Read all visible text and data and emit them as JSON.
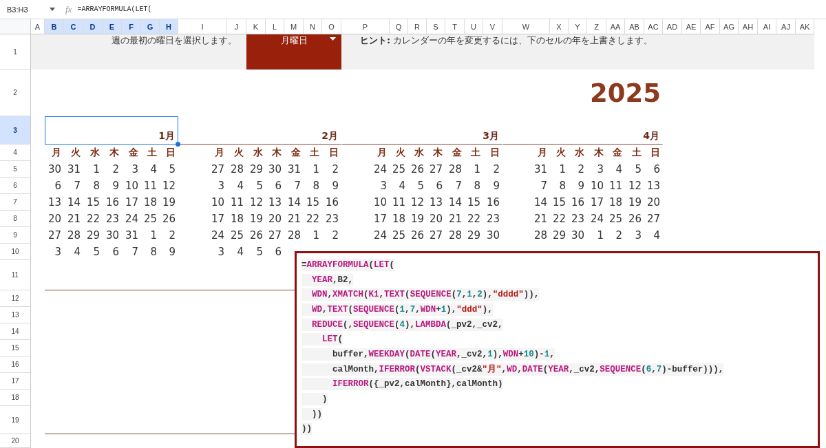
{
  "formula_bar": {
    "name_box": "B3:H3",
    "fx": "fx",
    "formula": "=ARRAYFORMULA(LET("
  },
  "columns": [
    {
      "label": "A",
      "selected": false
    },
    {
      "label": "B",
      "selected": true
    },
    {
      "label": "C",
      "selected": true
    },
    {
      "label": "D",
      "selected": true
    },
    {
      "label": "E",
      "selected": true
    },
    {
      "label": "F",
      "selected": true
    },
    {
      "label": "G",
      "selected": true
    },
    {
      "label": "H",
      "selected": true
    },
    {
      "label": "I",
      "selected": false
    },
    {
      "label": "J",
      "selected": false
    },
    {
      "label": "K",
      "selected": false
    },
    {
      "label": "L",
      "selected": false
    },
    {
      "label": "M",
      "selected": false
    },
    {
      "label": "N",
      "selected": false
    },
    {
      "label": "O",
      "selected": false
    },
    {
      "label": "P",
      "selected": false
    },
    {
      "label": "Q",
      "selected": false
    },
    {
      "label": "R",
      "selected": false
    },
    {
      "label": "S",
      "selected": false
    },
    {
      "label": "T",
      "selected": false
    },
    {
      "label": "U",
      "selected": false
    },
    {
      "label": "V",
      "selected": false
    },
    {
      "label": "W",
      "selected": false
    },
    {
      "label": "X",
      "selected": false
    },
    {
      "label": "Y",
      "selected": false
    },
    {
      "label": "Z",
      "selected": false
    },
    {
      "label": "AA",
      "selected": false
    },
    {
      "label": "AB",
      "selected": false
    },
    {
      "label": "AC",
      "selected": false
    },
    {
      "label": "AD",
      "selected": false
    },
    {
      "label": "AE",
      "selected": false
    },
    {
      "label": "AF",
      "selected": false
    },
    {
      "label": "AG",
      "selected": false
    },
    {
      "label": "AH",
      "selected": false
    },
    {
      "label": "AI",
      "selected": false
    },
    {
      "label": "AJ",
      "selected": false
    },
    {
      "label": "AK",
      "selected": false
    }
  ],
  "rows": [
    {
      "label": "1",
      "selected": false
    },
    {
      "label": "2",
      "selected": false
    },
    {
      "label": "3",
      "selected": true
    },
    {
      "label": "4",
      "selected": false
    },
    {
      "label": "5",
      "selected": false
    },
    {
      "label": "6",
      "selected": false
    },
    {
      "label": "7",
      "selected": false
    },
    {
      "label": "8",
      "selected": false
    },
    {
      "label": "9",
      "selected": false
    },
    {
      "label": "10",
      "selected": false
    },
    {
      "label": "11",
      "selected": false
    },
    {
      "label": "12",
      "selected": false
    },
    {
      "label": "13",
      "selected": false
    },
    {
      "label": "14",
      "selected": false
    },
    {
      "label": "15",
      "selected": false
    },
    {
      "label": "16",
      "selected": false
    },
    {
      "label": "17",
      "selected": false
    },
    {
      "label": "18",
      "selected": false
    },
    {
      "label": "19",
      "selected": false
    },
    {
      "label": "20",
      "selected": false
    }
  ],
  "intro_text": "週の最初の曜日を選択します。",
  "week_start_dropdown": {
    "value": "月曜日"
  },
  "hint": "**ヒント:** カレンダーの年を変更するには、下のセルの年を上書きします。",
  "year": "2025",
  "months": [
    {
      "label": "1月",
      "selected": true,
      "weekdays": [
        "月",
        "火",
        "水",
        "木",
        "金",
        "土",
        "日"
      ],
      "weeks": [
        [
          "30",
          "31",
          "1",
          "2",
          "3",
          "4",
          "5"
        ],
        [
          "6",
          "7",
          "8",
          "9",
          "10",
          "11",
          "12"
        ],
        [
          "13",
          "14",
          "15",
          "16",
          "17",
          "18",
          "19"
        ],
        [
          "20",
          "21",
          "22",
          "23",
          "24",
          "25",
          "26"
        ],
        [
          "27",
          "28",
          "29",
          "30",
          "31",
          "1",
          "2"
        ],
        [
          "3",
          "4",
          "5",
          "6",
          "7",
          "8",
          "9"
        ]
      ]
    },
    {
      "label": "2月",
      "selected": false,
      "weekdays": [
        "月",
        "火",
        "水",
        "木",
        "金",
        "土",
        "日"
      ],
      "weeks": [
        [
          "27",
          "28",
          "29",
          "30",
          "31",
          "1",
          "2"
        ],
        [
          "3",
          "4",
          "5",
          "6",
          "7",
          "8",
          "9"
        ],
        [
          "10",
          "11",
          "12",
          "13",
          "14",
          "15",
          "16"
        ],
        [
          "17",
          "18",
          "19",
          "20",
          "21",
          "22",
          "23"
        ],
        [
          "24",
          "25",
          "26",
          "27",
          "28",
          "1",
          "2"
        ],
        [
          "3",
          "4",
          "5",
          "6"
        ]
      ]
    },
    {
      "label": "3月",
      "selected": false,
      "weekdays": [
        "月",
        "火",
        "水",
        "木",
        "金",
        "土",
        "日"
      ],
      "weeks": [
        [
          "24",
          "25",
          "26",
          "27",
          "28",
          "1",
          "2"
        ],
        [
          "3",
          "4",
          "5",
          "6",
          "7",
          "8",
          "9"
        ],
        [
          "10",
          "11",
          "12",
          "13",
          "14",
          "15",
          "16"
        ],
        [
          "17",
          "18",
          "19",
          "20",
          "21",
          "22",
          "23"
        ],
        [
          "24",
          "25",
          "26",
          "27",
          "28",
          "29",
          "30"
        ]
      ]
    },
    {
      "label": "4月",
      "selected": false,
      "weekdays": [
        "月",
        "火",
        "水",
        "木",
        "金",
        "土",
        "日"
      ],
      "weeks": [
        [
          "31",
          "1",
          "2",
          "3",
          "4",
          "5",
          "6"
        ],
        [
          "7",
          "8",
          "9",
          "10",
          "11",
          "12",
          "13"
        ],
        [
          "14",
          "15",
          "16",
          "17",
          "18",
          "19",
          "20"
        ],
        [
          "21",
          "22",
          "23",
          "24",
          "25",
          "26",
          "27"
        ],
        [
          "28",
          "29",
          "30",
          "1",
          "2",
          "3",
          "4"
        ]
      ]
    }
  ],
  "formula_popup": {
    "lines": [
      {
        "tokens": [
          {
            "text": "=",
            "kind": "plain"
          },
          {
            "text": "ARRAYFORMULA",
            "kind": "fn"
          },
          {
            "text": "(",
            "kind": "plain"
          },
          {
            "text": "LET",
            "kind": "fn"
          },
          {
            "text": "(",
            "kind": "plain"
          }
        ]
      },
      {
        "tokens": [
          {
            "text": "  YEAR",
            "kind": "fn"
          },
          {
            "text": ",B2,",
            "kind": "plain"
          }
        ]
      },
      {
        "tokens": [
          {
            "text": "  WDN",
            "kind": "fn"
          },
          {
            "text": ",",
            "kind": "plain"
          },
          {
            "text": "XMATCH",
            "kind": "fn"
          },
          {
            "text": "(",
            "kind": "plain"
          },
          {
            "text": "K1",
            "kind": "fn"
          },
          {
            "text": ",",
            "kind": "plain"
          },
          {
            "text": "TEXT",
            "kind": "fn"
          },
          {
            "text": "(",
            "kind": "plain"
          },
          {
            "text": "SEQUENCE",
            "kind": "fn"
          },
          {
            "text": "(",
            "kind": "plain"
          },
          {
            "text": "7",
            "kind": "num"
          },
          {
            "text": ",",
            "kind": "plain"
          },
          {
            "text": "1",
            "kind": "num"
          },
          {
            "text": ",",
            "kind": "plain"
          },
          {
            "text": "2",
            "kind": "num"
          },
          {
            "text": "),",
            "kind": "plain"
          },
          {
            "text": "\"dddd\"",
            "kind": "str"
          },
          {
            "text": ")),",
            "kind": "plain"
          }
        ]
      },
      {
        "tokens": [
          {
            "text": "  WD",
            "kind": "fn"
          },
          {
            "text": ",",
            "kind": "plain"
          },
          {
            "text": "TEXT",
            "kind": "fn"
          },
          {
            "text": "(",
            "kind": "plain"
          },
          {
            "text": "SEQUENCE",
            "kind": "fn"
          },
          {
            "text": "(",
            "kind": "plain"
          },
          {
            "text": "1",
            "kind": "num"
          },
          {
            "text": ",",
            "kind": "plain"
          },
          {
            "text": "7",
            "kind": "num"
          },
          {
            "text": ",",
            "kind": "plain"
          },
          {
            "text": "WDN",
            "kind": "fn"
          },
          {
            "text": "+",
            "kind": "plain"
          },
          {
            "text": "1",
            "kind": "num"
          },
          {
            "text": "),",
            "kind": "plain"
          },
          {
            "text": "\"ddd\"",
            "kind": "str"
          },
          {
            "text": "),",
            "kind": "plain"
          }
        ]
      },
      {
        "tokens": [
          {
            "text": "  REDUCE",
            "kind": "fn"
          },
          {
            "text": "(,",
            "kind": "plain"
          },
          {
            "text": "SEQUENCE",
            "kind": "fn"
          },
          {
            "text": "(",
            "kind": "plain"
          },
          {
            "text": "4",
            "kind": "num"
          },
          {
            "text": "),",
            "kind": "plain"
          },
          {
            "text": "LAMBDA",
            "kind": "fn"
          },
          {
            "text": "(_pv2,_cv2,",
            "kind": "plain"
          }
        ]
      },
      {
        "tokens": [
          {
            "text": "    LET",
            "kind": "fn"
          },
          {
            "text": "(",
            "kind": "plain"
          }
        ]
      },
      {
        "tokens": [
          {
            "text": "      buffer,",
            "kind": "plain"
          },
          {
            "text": "WEEKDAY",
            "kind": "fn"
          },
          {
            "text": "(",
            "kind": "plain"
          },
          {
            "text": "DATE",
            "kind": "fn"
          },
          {
            "text": "(",
            "kind": "plain"
          },
          {
            "text": "YEAR",
            "kind": "fn"
          },
          {
            "text": ",_cv2,",
            "kind": "plain"
          },
          {
            "text": "1",
            "kind": "num"
          },
          {
            "text": "),",
            "kind": "plain"
          },
          {
            "text": "WDN",
            "kind": "fn"
          },
          {
            "text": "+",
            "kind": "plain"
          },
          {
            "text": "10",
            "kind": "num"
          },
          {
            "text": ")-",
            "kind": "plain"
          },
          {
            "text": "1",
            "kind": "num"
          },
          {
            "text": ",",
            "kind": "plain"
          }
        ]
      },
      {
        "tokens": [
          {
            "text": "      calMonth,",
            "kind": "plain"
          },
          {
            "text": "IFERROR",
            "kind": "fn"
          },
          {
            "text": "(",
            "kind": "plain"
          },
          {
            "text": "VSTACK",
            "kind": "fn"
          },
          {
            "text": "(_cv2&",
            "kind": "plain"
          },
          {
            "text": "\"月\"",
            "kind": "str"
          },
          {
            "text": ",",
            "kind": "plain"
          },
          {
            "text": "WD",
            "kind": "fn"
          },
          {
            "text": ",",
            "kind": "plain"
          },
          {
            "text": "DATE",
            "kind": "fn"
          },
          {
            "text": "(",
            "kind": "plain"
          },
          {
            "text": "YEAR",
            "kind": "fn"
          },
          {
            "text": ",_cv2,",
            "kind": "plain"
          },
          {
            "text": "SEQUENCE",
            "kind": "fn"
          },
          {
            "text": "(",
            "kind": "plain"
          },
          {
            "text": "6",
            "kind": "num"
          },
          {
            "text": ",",
            "kind": "plain"
          },
          {
            "text": "7",
            "kind": "num"
          },
          {
            "text": ")-buffer))),",
            "kind": "plain"
          }
        ]
      },
      {
        "tokens": [
          {
            "text": "      IFERROR",
            "kind": "fn"
          },
          {
            "text": "({_pv2,calMonth},calMonth)",
            "kind": "plain"
          }
        ]
      },
      {
        "tokens": [
          {
            "text": "    )",
            "kind": "plain"
          }
        ]
      },
      {
        "tokens": [
          {
            "text": "  ))",
            "kind": "plain"
          }
        ]
      },
      {
        "tokens": [
          {
            "text": "))",
            "kind": "plain"
          }
        ]
      }
    ]
  }
}
